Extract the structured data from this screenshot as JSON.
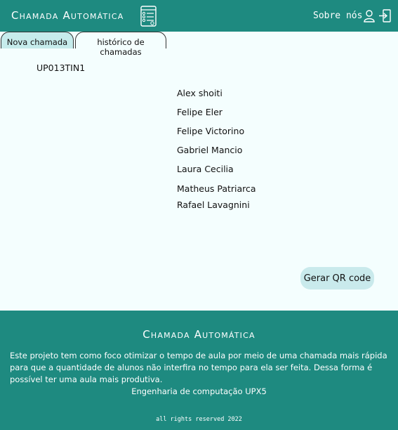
{
  "header": {
    "brand": "Chamada Automática",
    "brand_icon": "checklist-icon",
    "about_label": "Sobre nós",
    "user_icon": "user-icon",
    "logout_icon": "logout-icon"
  },
  "tabs": [
    {
      "label": "Nova chamada",
      "active": true
    },
    {
      "label": "histórico de chamadas",
      "active": false
    }
  ],
  "main": {
    "class_code": "UP013TIN1",
    "students": [
      "Alex shoiti",
      "Felipe Eler",
      "Felipe Victorino",
      "Gabriel Mancio",
      "Laura Cecilia",
      "Matheus Patriarca",
      "Rafael Lavagnini"
    ],
    "qr_button_label": "Gerar QR code"
  },
  "footer": {
    "title": "Chamada Automática",
    "description": "Este projeto tem como foco otimizar o tempo de aula por meio de uma chamada mais rápida para que a quantidade de alunos não interfira no tempo para ela ser feita. Dessa forma é possível ter uma aula mais produtiva.",
    "course": "Engenharia de computação UPX5",
    "rights": "all rights reserved 2022"
  },
  "colors": {
    "primary": "#1e8a80",
    "background": "#f4fefe",
    "active_tab": "#c6ecec",
    "button": "#c9eaec"
  }
}
